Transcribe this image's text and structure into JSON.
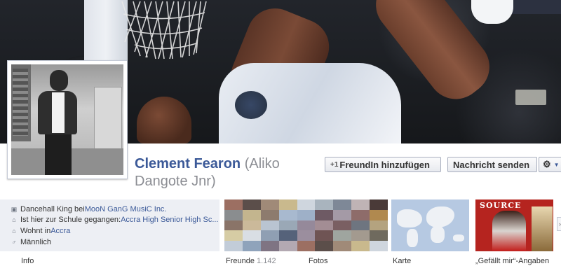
{
  "profile": {
    "name": "Clement Fearon",
    "alternate_name": "(Aliko Dangote Jnr)"
  },
  "actions": {
    "add_friend": "FreundIn hinzufügen",
    "add_friend_icon": "plus-one-icon",
    "send_message": "Nachricht senden",
    "settings_icon": "gear-icon"
  },
  "info": {
    "work_prefix": "Dancehall King bei ",
    "work_link": "MooN GanG MusiC Inc.",
    "school_prefix": "Ist hier zur Schule gegangen: ",
    "school_link": "Accra High Senior High Sc...",
    "home_prefix": "Wohnt in ",
    "home_link": "Accra",
    "gender": "Männlich"
  },
  "tabs": {
    "info": "Info",
    "friends": "Freunde",
    "friends_count": "1.142",
    "photos": "Fotos",
    "map": "Karte",
    "likes": "„Gefällt mir“-Angaben"
  },
  "likes_thumb": {
    "title": "SOURCE"
  },
  "colors": {
    "link": "#3b5998",
    "info_bg": "#edeff4",
    "muted": "#8b8d93"
  }
}
